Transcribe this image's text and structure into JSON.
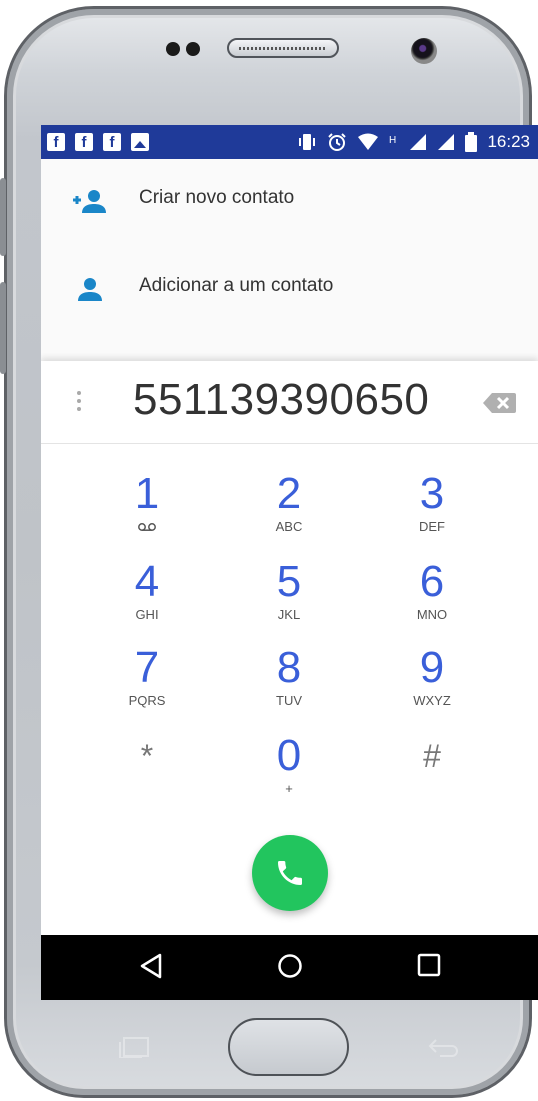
{
  "status_bar": {
    "time": "16:23",
    "left_icons": [
      "facebook-icon",
      "facebook-icon",
      "facebook-icon",
      "image-icon"
    ],
    "right_icons": [
      "vibrate-icon",
      "alarm-icon",
      "wifi-icon",
      "h-network-icon",
      "signal-icon",
      "signal-icon",
      "battery-icon"
    ],
    "color": "#1f3a99"
  },
  "actions": [
    {
      "label": "Criar novo contato",
      "icon": "add-contact-icon"
    },
    {
      "label": "Adicionar a um contato",
      "icon": "person-icon"
    }
  ],
  "dialer": {
    "number": "551139390650",
    "accent": "#3a5fd9",
    "keys": [
      {
        "digit": "1",
        "letters": ""
      },
      {
        "digit": "2",
        "letters": "ABC"
      },
      {
        "digit": "3",
        "letters": "DEF"
      },
      {
        "digit": "4",
        "letters": "GHI"
      },
      {
        "digit": "5",
        "letters": "JKL"
      },
      {
        "digit": "6",
        "letters": "MNO"
      },
      {
        "digit": "7",
        "letters": "PQRS"
      },
      {
        "digit": "8",
        "letters": "TUV"
      },
      {
        "digit": "9",
        "letters": "WXYZ"
      },
      {
        "digit": "*",
        "letters": ""
      },
      {
        "digit": "0",
        "letters": "+"
      },
      {
        "digit": "#",
        "letters": ""
      }
    ],
    "call_color": "#22c55e"
  },
  "nav": [
    "back-icon",
    "home-icon",
    "recents-icon"
  ]
}
